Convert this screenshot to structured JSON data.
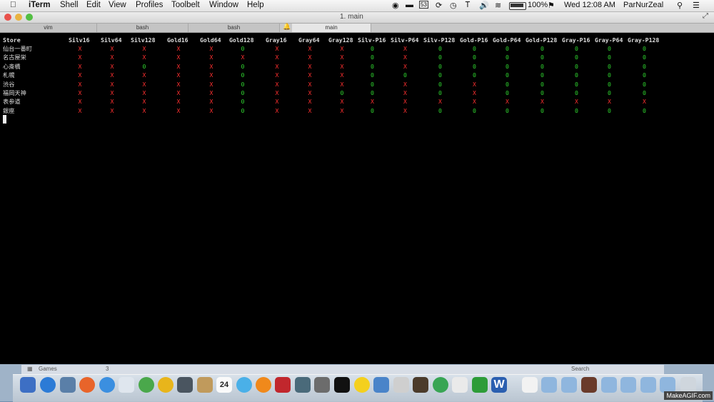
{
  "menubar": {
    "app": "iTerm",
    "items": [
      "Shell",
      "Edit",
      "View",
      "Profiles",
      "Toolbelt",
      "Window",
      "Help"
    ],
    "status": {
      "battery": "100%",
      "clock": "Wed 12:08 AM",
      "user": "ParNurZeal",
      "temp": "53"
    }
  },
  "window": {
    "title": "1. main"
  },
  "tabs": [
    {
      "label": "vim"
    },
    {
      "label": "bash"
    },
    {
      "label": "bash"
    },
    {
      "label": "main"
    }
  ],
  "table": {
    "headers": [
      "Store",
      "Silv16",
      "Silv64",
      "Silv128",
      "Gold16",
      "Gold64",
      "Gold128",
      "Gray16",
      "Gray64",
      "Gray128",
      "Silv-P16",
      "Silv-P64",
      "Silv-P128",
      "Gold-P16",
      "Gold-P64",
      "Gold-P128",
      "Gray-P16",
      "Gray-P64",
      "Gray-P128"
    ],
    "rows": [
      {
        "store": "仙台一番町",
        "cells": [
          "X",
          "X",
          "X",
          "X",
          "X",
          "0",
          "X",
          "X",
          "X",
          "0",
          "X",
          "0",
          "0",
          "0",
          "0",
          "0",
          "0",
          "0"
        ]
      },
      {
        "store": "名古屋栄",
        "cells": [
          "X",
          "X",
          "X",
          "X",
          "X",
          "X",
          "X",
          "X",
          "X",
          "0",
          "X",
          "0",
          "0",
          "0",
          "0",
          "0",
          "0",
          "0"
        ]
      },
      {
        "store": "心斎橋",
        "cells": [
          "X",
          "X",
          "0",
          "X",
          "X",
          "0",
          "X",
          "X",
          "X",
          "0",
          "X",
          "0",
          "0",
          "0",
          "0",
          "0",
          "0",
          "0"
        ]
      },
      {
        "store": "札幌",
        "cells": [
          "X",
          "X",
          "X",
          "X",
          "X",
          "0",
          "X",
          "X",
          "X",
          "0",
          "0",
          "0",
          "0",
          "0",
          "0",
          "0",
          "0",
          "0"
        ]
      },
      {
        "store": "渋谷",
        "cells": [
          "X",
          "X",
          "X",
          "X",
          "X",
          "0",
          "X",
          "X",
          "X",
          "0",
          "X",
          "0",
          "X",
          "0",
          "0",
          "0",
          "0",
          "0"
        ]
      },
      {
        "store": "福岡天神",
        "cells": [
          "X",
          "X",
          "X",
          "X",
          "X",
          "0",
          "X",
          "X",
          "0",
          "0",
          "X",
          "0",
          "X",
          "0",
          "0",
          "0",
          "0",
          "0"
        ]
      },
      {
        "store": "表参道",
        "cells": [
          "X",
          "X",
          "X",
          "X",
          "X",
          "0",
          "X",
          "X",
          "X",
          "X",
          "X",
          "X",
          "X",
          "X",
          "X",
          "X",
          "X",
          "X"
        ]
      },
      {
        "store": "銀座",
        "cells": [
          "X",
          "X",
          "X",
          "X",
          "X",
          "0",
          "X",
          "X",
          "X",
          "0",
          "X",
          "0",
          "0",
          "0",
          "0",
          "0",
          "0",
          "0"
        ]
      }
    ]
  },
  "dock": {
    "calendar_day": "24"
  },
  "behind_window": {
    "row_label": "Games",
    "row_count": "3",
    "search_placeholder": "Search"
  },
  "watermark": "MakeAGIF.com",
  "colors": {
    "x": "#ff3030",
    "o": "#2fd42f",
    "terminal_bg": "#000000"
  }
}
